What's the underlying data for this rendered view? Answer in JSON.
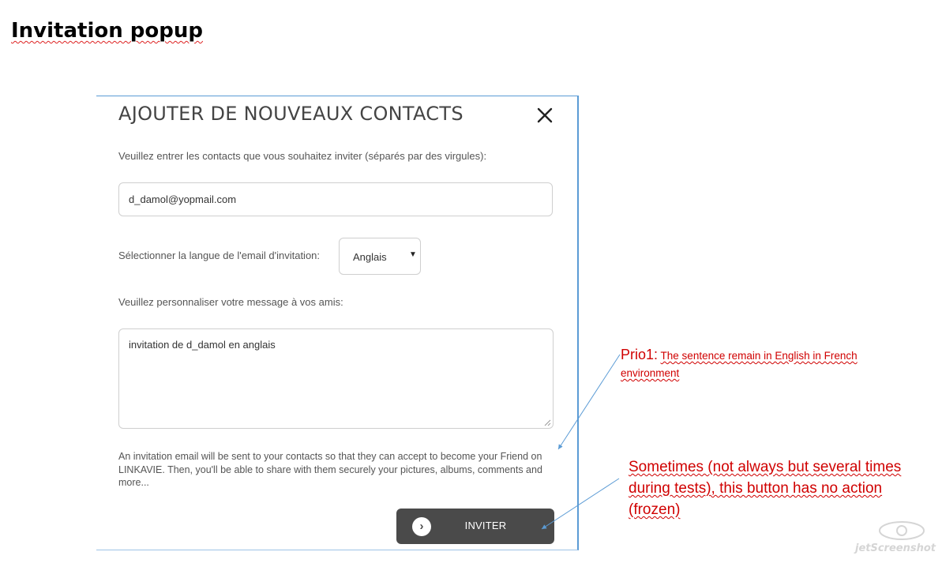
{
  "page": {
    "title": "Invitation popup"
  },
  "popup": {
    "title": "AJOUTER DE NOUVEAUX CONTACTS",
    "contacts_label": "Veuillez entrer les contacts que vous souhaitez inviter (séparés par des virgules):",
    "contacts_value": "d_damol@yopmail.com",
    "language_label": "Sélectionner la langue de l'email d'invitation:",
    "language_selected": "Anglais",
    "message_label": "Veuillez personnaliser votre message à vos amis:",
    "message_value": "invitation de d_damol en anglais",
    "info_text": "An invitation email will be sent to your contacts so that they can accept to become your Friend on LINKAVIE. Then, you'll be able to share with them securely your pictures, albums, comments and more...",
    "invite_button_label": "INVITER",
    "close_icon": "close-icon",
    "arrow_icon": "chevron-right-icon"
  },
  "annotations": {
    "prio_label": "Prio1:",
    "prio_text": "The sentence remain in English in French environment",
    "button_note": "Sometimes (not always but several times during tests), this button has no action (frozen)",
    "color": "#d00000"
  },
  "watermark": {
    "text": "jetScreenshot"
  }
}
